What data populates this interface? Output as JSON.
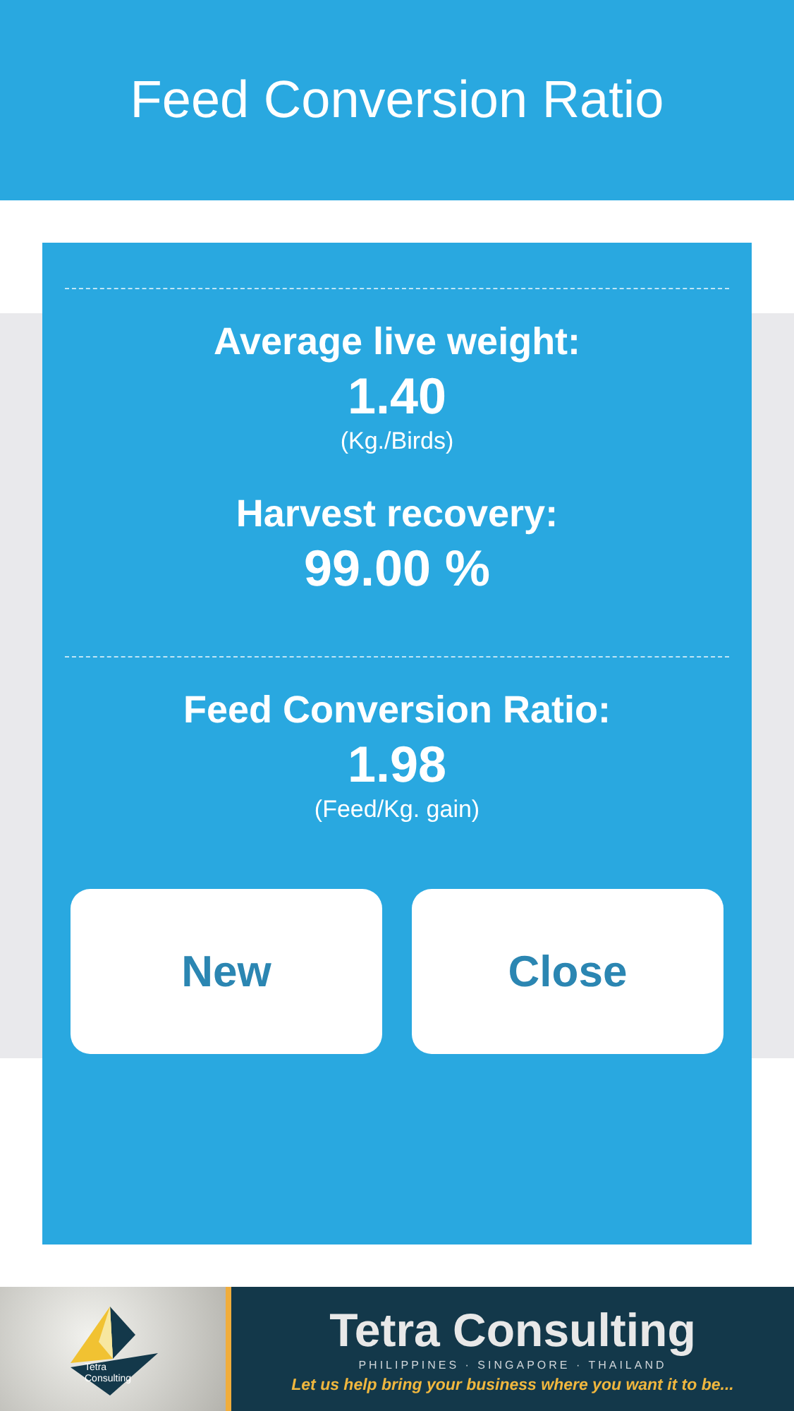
{
  "header": {
    "title": "Feed Conversion Ratio"
  },
  "sections": [
    {
      "items": [
        {
          "label": "Average live weight:",
          "value": "1.40",
          "unit": "(Kg./Birds)"
        },
        {
          "label": "Harvest recovery:",
          "value": "99.00 %"
        }
      ]
    },
    {
      "items": [
        {
          "label": "Feed Conversion Ratio:",
          "value": "1.98",
          "unit": "(Feed/Kg. gain)"
        }
      ]
    }
  ],
  "buttons": [
    "New",
    "Close"
  ],
  "banner": {
    "logo_text": "Tetra Consulting",
    "title": "Tetra Consulting",
    "subtitle": "PHILIPPINES · SINGAPORE · THAILAND",
    "slogan": "Let us  help bring your business where you want it to be..."
  }
}
